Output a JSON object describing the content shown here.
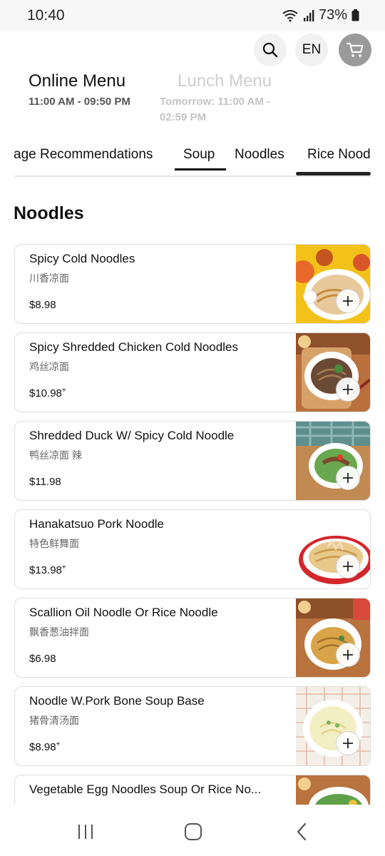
{
  "status_bar": {
    "time": "10:40",
    "battery": "73%"
  },
  "header": {
    "language": "EN",
    "search_icon": "search-icon",
    "cart_icon": "cart-icon"
  },
  "menus": [
    {
      "name": "Online Menu",
      "hours": "11:00 AM - 09:50 PM",
      "active": true
    },
    {
      "name": "Lunch Menu",
      "hours_line1": "Tomorrow: 11:00 AM -",
      "hours_line2": "02:59 PM",
      "active": false
    }
  ],
  "categories": {
    "items": [
      "age Recommendations",
      "Soup",
      "Noodles",
      "Rice Nood"
    ],
    "selected": "Soup"
  },
  "section": {
    "title": "Noodles"
  },
  "items": [
    {
      "name": "Spicy Cold Noodles",
      "chinese": "川香凉面",
      "price": "$8.98",
      "price_plus": ""
    },
    {
      "name": "Spicy Shredded Chicken Cold Noodles",
      "chinese": "鸡丝凉面",
      "price": "$10.98",
      "price_plus": "+"
    },
    {
      "name": "Shredded Duck W/ Spicy Cold Noodle",
      "chinese": "鸭丝凉面 辣",
      "price": "$11.98",
      "price_plus": ""
    },
    {
      "name": "Hanakatsuo Pork Noodle",
      "chinese": "特色鲜舞面",
      "price": "$13.98",
      "price_plus": "+"
    },
    {
      "name": "Scallion Oil Noodle Or Rice Noodle",
      "chinese": "飘香葱油拌面",
      "price": "$6.98",
      "price_plus": ""
    },
    {
      "name": "Noodle W.Pork Bone Soup Base",
      "chinese": "猪骨清汤面",
      "price": "$8.98",
      "price_plus": "+"
    },
    {
      "name": "Vegetable Egg Noodles Soup Or Rice No...",
      "chinese": "",
      "price": "",
      "price_plus": ""
    }
  ],
  "colors": {
    "accent": "#111111",
    "muted": "#c4c4c4",
    "cart_bg": "#9a9a9a"
  }
}
